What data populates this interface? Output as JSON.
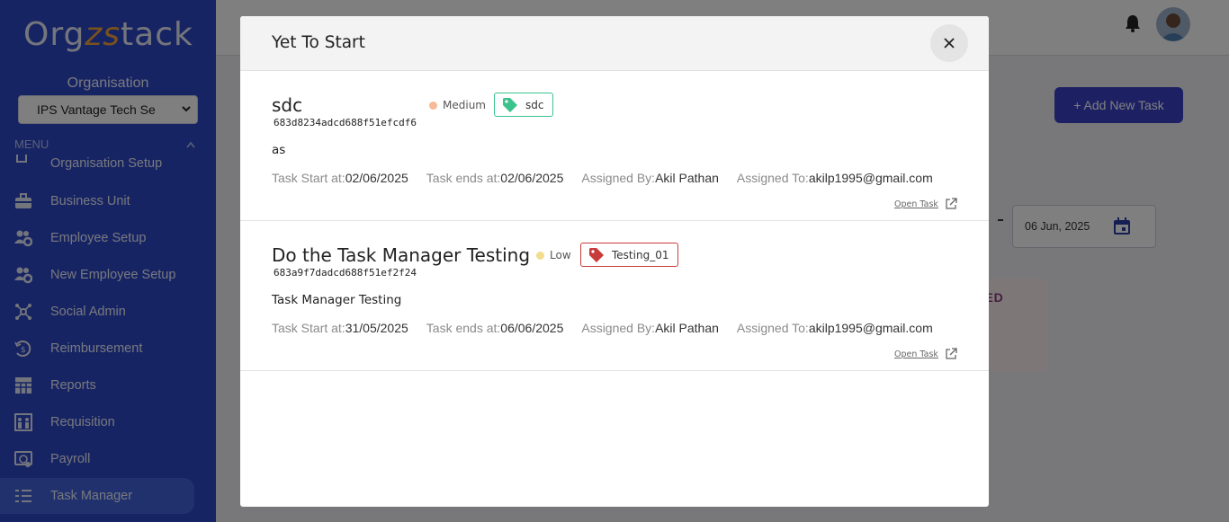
{
  "brand": {
    "logo_left": "Org",
    "logo_accent": "zs",
    "logo_right": "tack"
  },
  "sidebar": {
    "org_label": "Organisation",
    "org_value": "IPS Vantage Tech Se",
    "menu_label": "MENU",
    "partial_item": "Organisation Setup",
    "items": [
      {
        "label": "Business Unit",
        "icon": "briefcase-icon"
      },
      {
        "label": "Employee Setup",
        "icon": "users-gear-icon"
      },
      {
        "label": "New Employee Setup",
        "icon": "users-gear-icon"
      },
      {
        "label": "Social Admin",
        "icon": "network-icon"
      },
      {
        "label": "Reimbursement",
        "icon": "refund-icon"
      },
      {
        "label": "Reports",
        "icon": "grid-report-icon"
      },
      {
        "label": "Requisition",
        "icon": "requisition-icon"
      },
      {
        "label": "Payroll",
        "icon": "payroll-icon"
      },
      {
        "label": "Task Manager",
        "icon": "task-list-icon",
        "active": true
      }
    ]
  },
  "page": {
    "add_task_label": "+ Add New Task",
    "date_value": "06 Jun, 2025",
    "card_text": "YED"
  },
  "modal": {
    "title": "Yet To Start",
    "tasks": [
      {
        "title": "sdc",
        "id": "683d8234adcd688f51efcdf6",
        "priority": "Medium",
        "priority_color": "#f8b996",
        "tag": "sdc",
        "tag_color": "#3cc28d",
        "description": "as",
        "start_label": "Task Start at:",
        "start": "02/06/2025",
        "end_label": "Task ends at:",
        "end": "02/06/2025",
        "assigned_by_label": "Assigned By:",
        "assigned_by": "Akil Pathan",
        "assigned_to_label": "Assigned To:",
        "assigned_to": "akilp1995@gmail.com",
        "open_label": "Open Task"
      },
      {
        "title": "Do the Task Manager Testing",
        "id": "683a9f7dadcd688f51ef2f24",
        "priority": "Low",
        "priority_color": "#f3dc8b",
        "tag": "Testing_01",
        "tag_color": "#c83b3b",
        "description": "Task Manager Testing",
        "start_label": "Task Start at:",
        "start": "31/05/2025",
        "end_label": "Task ends at:",
        "end": "06/06/2025",
        "assigned_by_label": "Assigned By:",
        "assigned_by": "Akil Pathan",
        "assigned_to_label": "Assigned To:",
        "assigned_to": "akilp1995@gmail.com",
        "open_label": "Open Task"
      }
    ]
  }
}
